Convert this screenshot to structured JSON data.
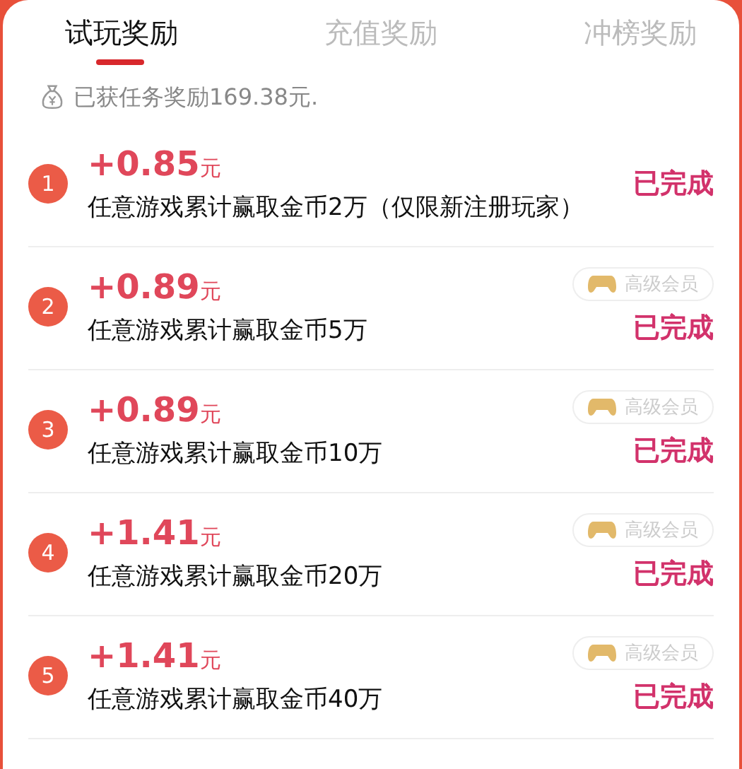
{
  "tabs": [
    {
      "label": "试玩奖励",
      "selected": true
    },
    {
      "label": "充值奖励",
      "selected": false
    },
    {
      "label": "冲榜奖励",
      "selected": false
    }
  ],
  "summary": "已获任务奖励169.38元.",
  "tasks": [
    {
      "index": "1",
      "amount": "+0.85",
      "unit": "元",
      "description": "任意游戏累计赢取金币2万（仅限新注册玩家）",
      "status": "已完成"
    },
    {
      "index": "2",
      "amount": "+0.89",
      "unit": "元",
      "description": "任意游戏累计赢取金币5万",
      "badge": "高级会员",
      "status": "已完成"
    },
    {
      "index": "3",
      "amount": "+0.89",
      "unit": "元",
      "description": "任意游戏累计赢取金币10万",
      "badge": "高级会员",
      "status": "已完成"
    },
    {
      "index": "4",
      "amount": "+1.41",
      "unit": "元",
      "description": "任意游戏累计赢取金币20万",
      "badge": "高级会员",
      "status": "已完成"
    },
    {
      "index": "5",
      "amount": "+1.41",
      "unit": "元",
      "description": "任意游戏累计赢取金币40万",
      "badge": "高级会员",
      "status": "已完成"
    }
  ]
}
